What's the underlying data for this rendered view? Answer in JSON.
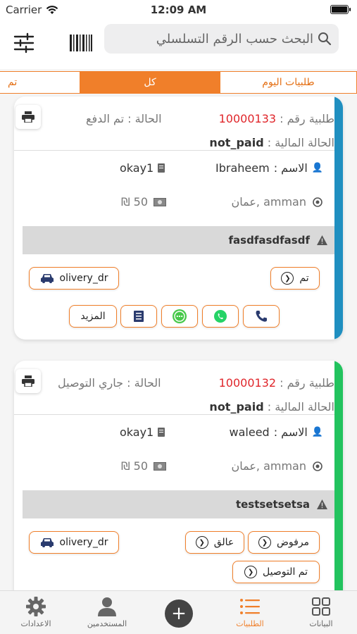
{
  "status_bar": {
    "carrier": "Carrier",
    "time": "12:09 AM"
  },
  "search": {
    "placeholder": "البحث حسب الرقم التسلسلي"
  },
  "tabs": [
    {
      "label": "طلبيات اليوم",
      "active": false
    },
    {
      "label": "كل",
      "active": true
    },
    {
      "label": "تم",
      "active": false
    }
  ],
  "labels": {
    "order_prefix": "طلبية رقم :",
    "financial_status": "الحالة المالية :",
    "name": "الاسم :",
    "more": "المزيد"
  },
  "orders": [
    {
      "number": "10000133",
      "status": "الحالة : تم الدفع",
      "financial_value": "not_paid",
      "name_value": "Ibraheem",
      "driver_code": "okay1",
      "address": "amman ,عمان",
      "amount": "50 ₪",
      "note": "fasdfasdfasdf",
      "driver": "olivery_dr",
      "actions": [
        "تم"
      ],
      "stripe_color": "#1f8fc0"
    },
    {
      "number": "10000132",
      "status": "الحالة : جاري التوصيل",
      "financial_value": "not_paid",
      "name_value": "waleed",
      "driver_code": "okay1",
      "address": "amman ,عمان",
      "amount": "50 ₪",
      "note": "testsetsetsa",
      "driver": "olivery_dr",
      "actions": [
        "مرفوض",
        "عالق",
        "تم التوصيل"
      ],
      "stripe_color": "#22c35e"
    }
  ],
  "bottom_nav": [
    {
      "label": "البيانات",
      "icon": "grid-icon",
      "active": false
    },
    {
      "label": "الطلبيات",
      "icon": "list-icon",
      "active": true
    },
    {
      "label": "المستخدمين",
      "icon": "user-icon",
      "active": false
    },
    {
      "label": "الاعدادات",
      "icon": "gear-icon",
      "active": false
    }
  ],
  "colors": {
    "accent": "#f07f2a",
    "order_number": "#e0262b",
    "whatsapp": "#25d366",
    "chat": "#47c94a"
  }
}
